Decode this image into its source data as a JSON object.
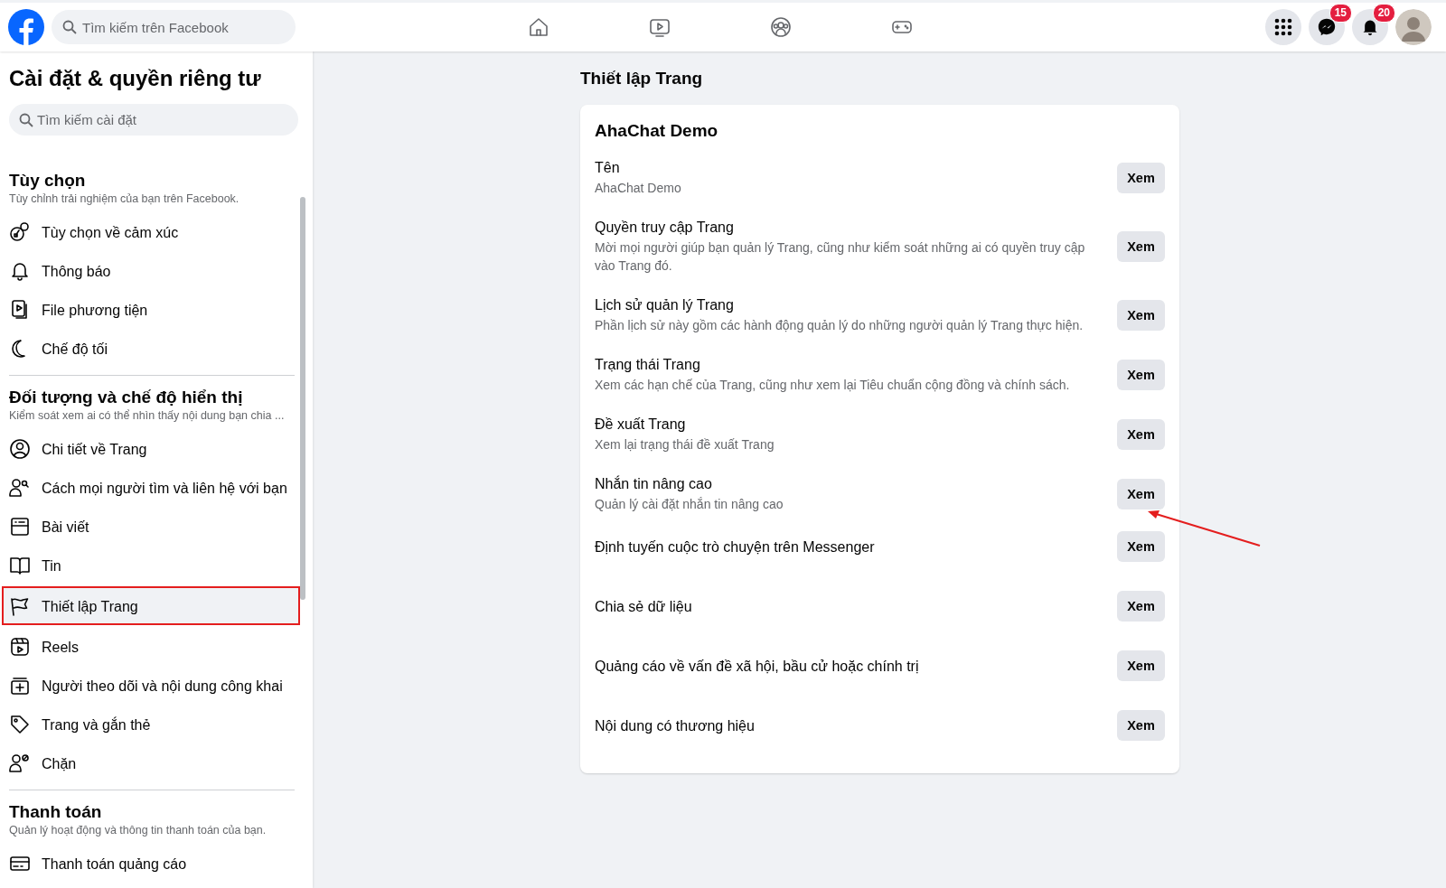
{
  "topbar": {
    "search": {
      "placeholder": "Tìm kiếm trên Facebook"
    },
    "actions": [
      {
        "kind": "menu"
      },
      {
        "kind": "messenger",
        "badge": "15"
      },
      {
        "kind": "notifications",
        "badge": "20"
      },
      {
        "kind": "avatar"
      }
    ]
  },
  "sidebar": {
    "title": "Cài đặt & quyền riêng tư",
    "search": {
      "placeholder": "Tìm kiếm cài đặt"
    },
    "sections": [
      {
        "heading": "Tùy chọn",
        "description": "Tùy chỉnh trải nghiệm của bạn trên Facebook.",
        "items": [
          {
            "label": "Tùy chọn về cảm xúc",
            "selected": false
          },
          {
            "label": "Thông báo",
            "selected": false
          },
          {
            "label": "File phương tiện",
            "selected": false
          },
          {
            "label": "Chế độ tối",
            "selected": false
          }
        ]
      },
      {
        "heading": "Đối tượng và chế độ hiển thị",
        "description": "Kiểm soát xem ai có thể nhìn thấy nội dung bạn chia ...",
        "items": [
          {
            "label": "Chi tiết về Trang",
            "selected": false
          },
          {
            "label": "Cách mọi người tìm và liên hệ với bạn",
            "selected": false
          },
          {
            "label": "Bài viết",
            "selected": false
          },
          {
            "label": "Tin",
            "selected": false
          },
          {
            "label": "Thiết lập Trang",
            "selected": true
          },
          {
            "label": "Reels",
            "selected": false
          },
          {
            "label": "Người theo dõi và nội dung công khai",
            "selected": false
          },
          {
            "label": "Trang và gắn thẻ",
            "selected": false
          },
          {
            "label": "Chặn",
            "selected": false
          }
        ]
      },
      {
        "heading": "Thanh toán",
        "description": "Quản lý hoạt động và thông tin thanh toán của bạn.",
        "items": [
          {
            "label": "Thanh toán quảng cáo",
            "selected": false
          }
        ]
      }
    ]
  },
  "main": {
    "heading": "Thiết lập Trang",
    "card": {
      "title": "AhaChat Demo",
      "rows": [
        {
          "title": "Tên",
          "description": "AhaChat Demo",
          "button": "Xem"
        },
        {
          "title": "Quyền truy cập Trang",
          "description": "Mời mọi người giúp bạn quản lý Trang, cũng như kiểm soát những ai có quyền truy cập vào Trang đó.",
          "button": "Xem"
        },
        {
          "title": "Lịch sử quản lý Trang",
          "description": "Phần lịch sử này gồm các hành động quản lý do những người quản lý Trang thực hiện.",
          "button": "Xem"
        },
        {
          "title": "Trạng thái Trang",
          "description": "Xem các hạn chế của Trang, cũng như xem lại Tiêu chuẩn cộng đồng và chính sách.",
          "button": "Xem"
        },
        {
          "title": "Đề xuất Trang",
          "description": "Xem lại trạng thái đề xuất Trang",
          "button": "Xem"
        },
        {
          "title": "Nhắn tin nâng cao",
          "description": "Quản lý cài đặt nhắn tin nâng cao",
          "button": "Xem"
        },
        {
          "title": "Định tuyến cuộc trò chuyện trên Messenger",
          "button": "Xem"
        },
        {
          "title": "Chia sẻ dữ liệu",
          "button": "Xem"
        },
        {
          "title": "Quảng cáo về vấn đề xã hội, bầu cử hoặc chính trị",
          "button": "Xem"
        },
        {
          "title": "Nội dung có thương hiệu",
          "button": "Xem"
        }
      ]
    }
  }
}
